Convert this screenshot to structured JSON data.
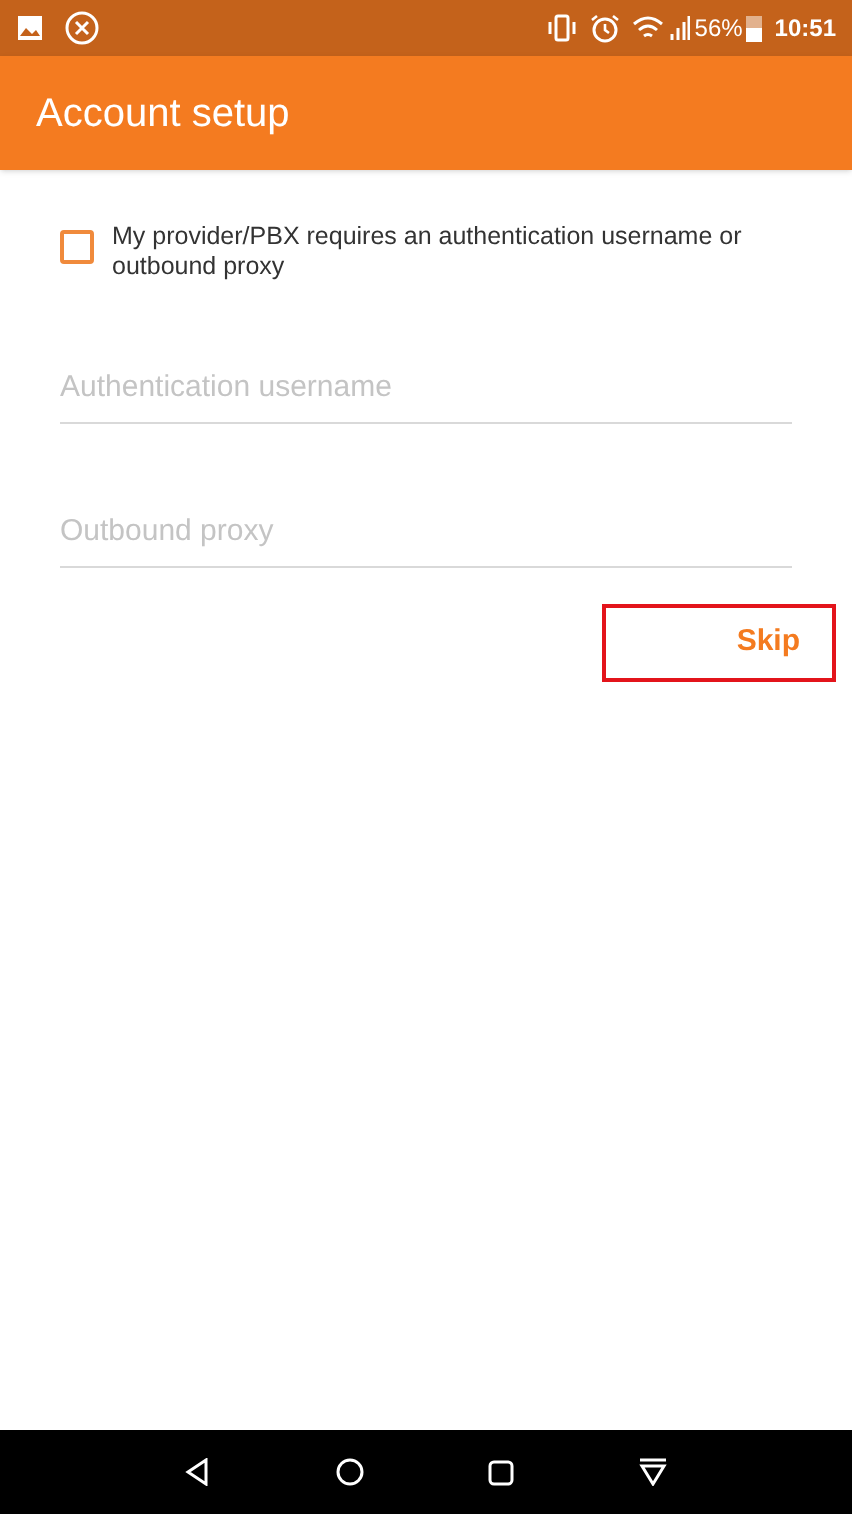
{
  "status_bar": {
    "battery": "56%",
    "time": "10:51"
  },
  "app_bar": {
    "title": "Account setup"
  },
  "checkbox": {
    "label": "My provider/PBX requires an authentication username or outbound proxy",
    "checked": false
  },
  "fields": [
    {
      "placeholder": "Authentication username"
    },
    {
      "placeholder": "Outbound proxy"
    }
  ],
  "skip_button": {
    "label": "Skip",
    "highlighted": true
  }
}
